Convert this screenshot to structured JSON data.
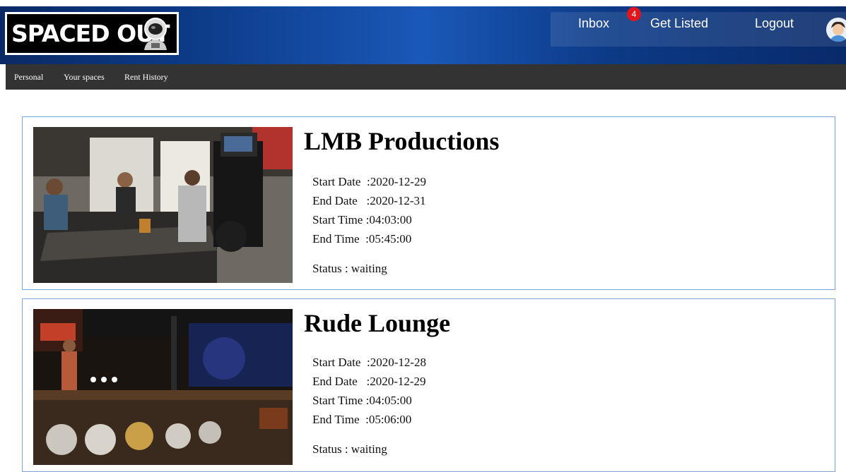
{
  "brand": {
    "logo_text": "SPACED OUT"
  },
  "nav": {
    "inbox": "Inbox",
    "inbox_badge": "4",
    "get_listed": "Get Listed",
    "logout": "Logout"
  },
  "subnav": [
    "Personal",
    "Your spaces",
    "Rent History"
  ],
  "labels": {
    "start_date": "Start Date",
    "end_date": "End Date",
    "start_time": "Start Time",
    "end_time": "End Time",
    "status": "Status"
  },
  "bookings": [
    {
      "title": "LMB Productions",
      "start_date": "2020-12-29",
      "end_date": "2020-12-31",
      "start_time": "04:03:00",
      "end_time": "05:45:00",
      "status": "waiting"
    },
    {
      "title": "Rude Lounge",
      "start_date": "2020-12-28",
      "end_date": "2020-12-29",
      "start_time": "04:05:00",
      "end_time": "05:06:00",
      "status": "waiting"
    }
  ],
  "colors": {
    "header_blue": "#0c3a86",
    "subnav_bg": "#333333",
    "card_border": "#7ba7d6",
    "badge": "#e0161d"
  }
}
